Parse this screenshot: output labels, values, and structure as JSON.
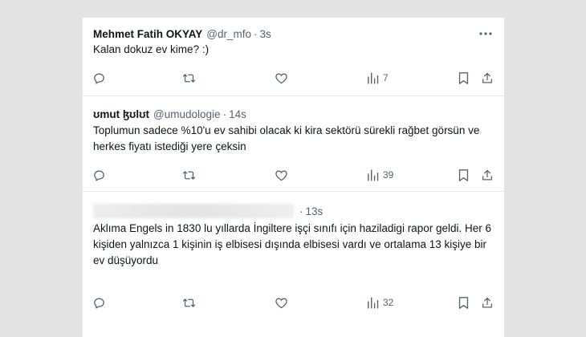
{
  "tweets": [
    {
      "name": "Mehmet Fatih OKYAY",
      "handle": "@dr_mfo",
      "dot": "·",
      "time": "3s",
      "text": "Kalan dokuz ev kime? :)",
      "views": "7"
    },
    {
      "name": "ʊmut ɮʊlʊt",
      "handle": "@umudologie",
      "dot": "·",
      "time": "14s",
      "text": "Toplumun sadece %10'u ev sahibi olacak ki kira sektörü sürekli rağbet görsün ve herkes fiyatı istediği yere çeksin",
      "views": "39"
    },
    {
      "name": "",
      "handle": "",
      "dot": "·",
      "time": "13s",
      "text": "Aklıma Engels in 1830 lu yıllarda İngiltere işçi sınıfı için haziladigi rapor geldi. Her 6 kişiden yalnızca 1 kişinin iş elbisesi dışında elbisesi vardı ve ortalama 13 kişiye bir ev düşüyordu",
      "views": "32"
    }
  ],
  "icons": {
    "more": "more-dots-icon",
    "reply": "reply-icon",
    "retweet": "retweet-icon",
    "like": "heart-icon",
    "views": "views-chart-icon",
    "bookmark": "bookmark-icon",
    "share": "share-icon"
  },
  "colors": {
    "background": "#e3e3e3",
    "card": "#ffffff",
    "text": "#0f1419",
    "secondary": "#536471",
    "divider": "#e6e9eb"
  }
}
